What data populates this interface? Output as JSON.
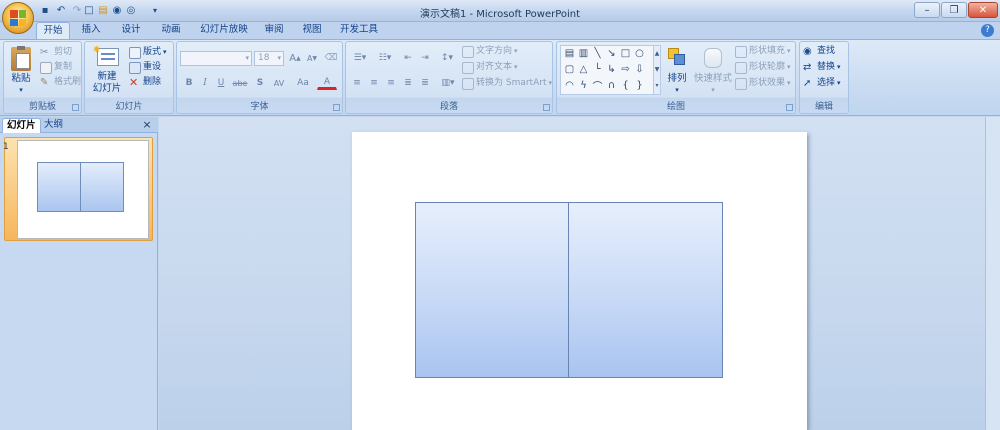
{
  "window": {
    "title": "演示文稿1 - Microsoft PowerPoint"
  },
  "tabs": [
    "开始",
    "插入",
    "设计",
    "动画",
    "幻灯片放映",
    "审阅",
    "视图",
    "开发工具"
  ],
  "ribbon": {
    "clipboard": {
      "label": "剪贴板",
      "paste": "粘贴",
      "cut": "剪切",
      "copy": "复制",
      "format_painter": "格式刷"
    },
    "slides": {
      "label": "幻灯片",
      "new_slide_line1": "新建",
      "new_slide_line2": "幻灯片",
      "layout": "版式",
      "reset": "重设",
      "delete": "删除"
    },
    "font": {
      "label": "字体",
      "font_size": "18",
      "bold": "B",
      "italic": "I",
      "underline": "U",
      "strikethrough": "abe",
      "shadow": "S",
      "spacing": "AV",
      "case": "Aa",
      "grow": "A",
      "shrink": "A"
    },
    "paragraph": {
      "label": "段落",
      "text_direction": "文字方向",
      "align_text": "对齐文本",
      "convert_smartart": "转换为 SmartArt"
    },
    "drawing": {
      "label": "绘图",
      "arrange": "排列",
      "quick_styles": "快速样式",
      "shape_fill": "形状填充",
      "shape_outline": "形状轮廓",
      "shape_effects": "形状效果"
    },
    "editing": {
      "label": "编辑",
      "find": "查找",
      "replace": "替换",
      "select": "选择"
    }
  },
  "pane": {
    "tab_slides": "幻灯片",
    "tab_outline": "大纲",
    "close": "×",
    "slide_number": "1"
  },
  "icons": {
    "help": "?",
    "minimize": "–",
    "restore": "❐",
    "close": "✕"
  },
  "colors": {
    "accent": "#15428b",
    "ribbon_bg": "#dde9f7",
    "thumb_selected": "#f6b65c",
    "shape_fill_top": "#e7effc",
    "shape_fill_bottom": "#a9c4f0"
  }
}
